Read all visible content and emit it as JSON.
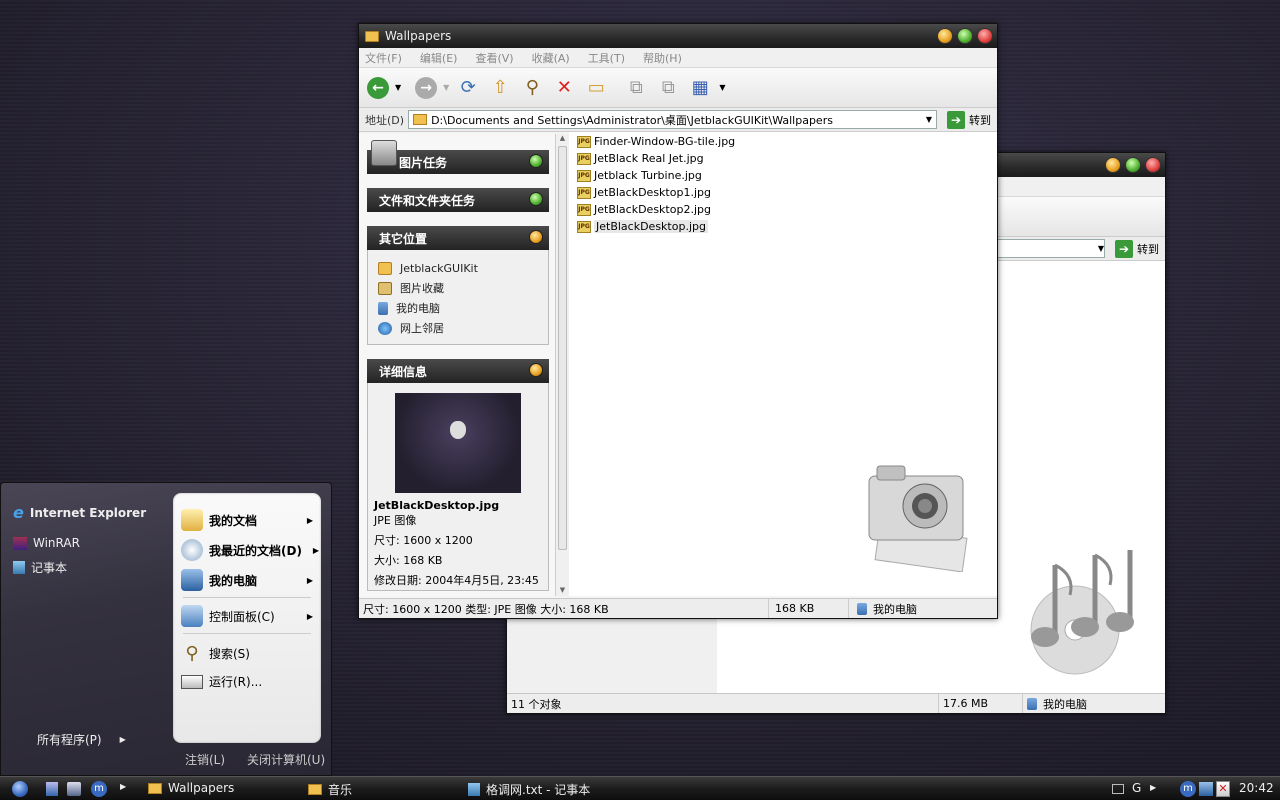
{
  "back_window": {
    "go_label": "转到",
    "status_objects": "11 个对象",
    "status_size": "17.6 MB",
    "status_location": "我的电脑"
  },
  "main_window": {
    "title": "Wallpapers",
    "menu": [
      "文件(F)",
      "编辑(E)",
      "查看(V)",
      "收藏(A)",
      "工具(T)",
      "帮助(H)"
    ],
    "address_label": "地址(D)",
    "address_value": "D:\\Documents and Settings\\Administrator\\桌面\\JetblackGUIKit\\Wallpapers",
    "go_label": "转到",
    "task_groups": {
      "picture_tasks": "图片任务",
      "file_folder_tasks": "文件和文件夹任务",
      "other_places": "其它位置",
      "details": "详细信息"
    },
    "other_places": [
      {
        "label": "JetblackGUIKit",
        "icon": "folder-icon"
      },
      {
        "label": "图片收藏",
        "icon": "pictures-folder-icon"
      },
      {
        "label": "我的电脑",
        "icon": "my-computer-icon"
      },
      {
        "label": "网上邻居",
        "icon": "network-icon"
      }
    ],
    "details": {
      "filename": "JetBlackDesktop.jpg",
      "type": "JPE 图像",
      "dimensions": "尺寸: 1600 x 1200",
      "size": "大小: 168 KB",
      "modified": "修改日期: 2004年4月5日, 23:45"
    },
    "files": [
      "Finder-Window-BG-tile.jpg",
      "JetBlack Real Jet.jpg",
      "Jetblack Turbine.jpg",
      "JetBlackDesktop1.jpg",
      "JetBlackDesktop2.jpg",
      "JetBlackDesktop.jpg"
    ],
    "status_info": "尺寸: 1600 x 1200 类型: JPE 图像 大小: 168 KB",
    "status_size": "168 KB",
    "status_location": "我的电脑"
  },
  "start_menu": {
    "pinned": [
      "Internet Explorer",
      "WinRAR",
      "记事本"
    ],
    "all_programs": "所有程序(P)",
    "right_items": [
      "我的文档",
      "我最近的文档(D)",
      "我的电脑",
      "控制面板(C)",
      "搜索(S)",
      "运行(R)..."
    ],
    "logoff": "注销(L)",
    "shutdown": "关闭计算机(U)"
  },
  "taskbar": {
    "tasks": [
      "Wallpapers",
      "音乐",
      "格调网.txt - 记事本"
    ],
    "tray_letter": "G",
    "clock": "20:42"
  },
  "colors": {
    "accent_green": "#3a9a3a",
    "titlebar_dark": "#1b1b1b",
    "desktop_purple": "#2a2638"
  }
}
